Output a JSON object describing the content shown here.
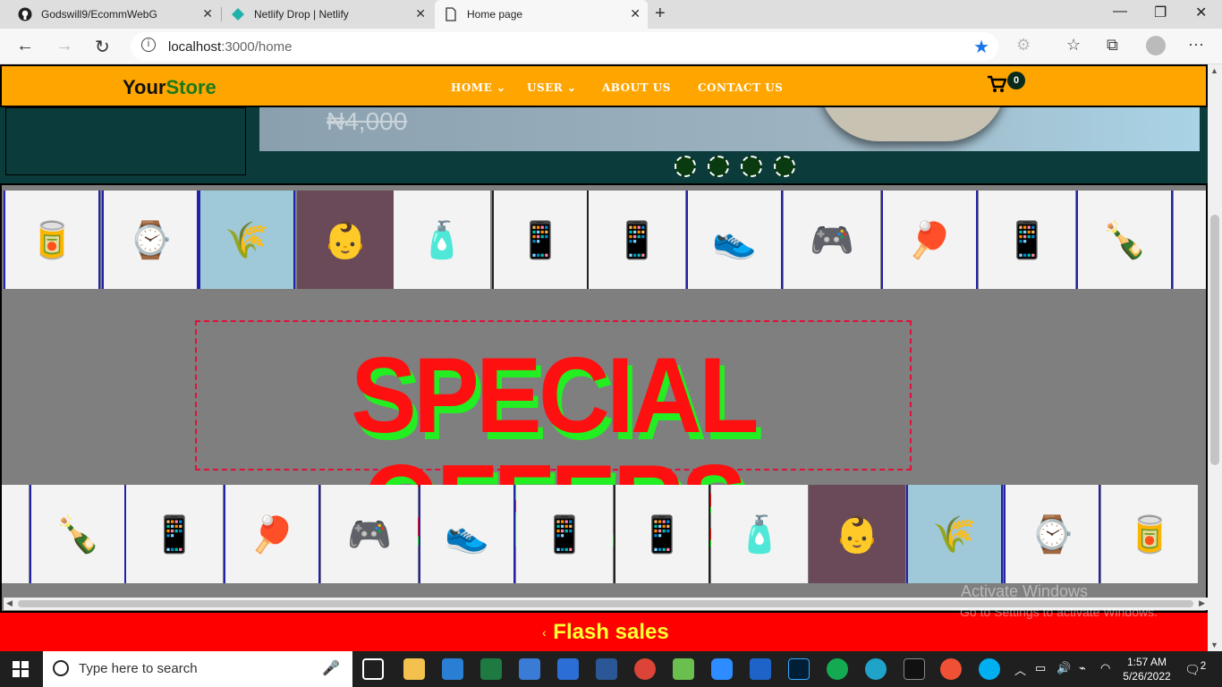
{
  "browser": {
    "tabs": [
      {
        "title": "Godswill9/EcommWebG"
      },
      {
        "title": "Netlify Drop | Netlify"
      },
      {
        "title": "Home page"
      }
    ],
    "url_host": "localhost",
    "url_rest": ":3000/home"
  },
  "navbar": {
    "brand_part1": "Your",
    "brand_part2": "Store",
    "menu": [
      "HOME",
      "USER",
      "ABOUT US",
      "CONTACT US"
    ],
    "cart_count": "0"
  },
  "hero": {
    "price": "₦4,000",
    "slide_dots": 4
  },
  "offers": {
    "title": "SPECIAL OFFERS",
    "top_strip": [
      "canned-food",
      "wristwatches",
      "rice-promo",
      "baby-in-hoodie",
      "toiletries",
      "phone-blue",
      "phone-grey",
      "sneakers",
      "game-console",
      "table-tennis",
      "tablet",
      "sauces"
    ],
    "bottom_strip": [
      "sauces",
      "tablet",
      "table-tennis",
      "game-console",
      "sneakers",
      "phone-grey",
      "phone-blue",
      "toiletries",
      "baby-in-hoodie",
      "rice-promo",
      "wristwatches",
      "canned-food"
    ]
  },
  "flash_sales": {
    "title": "Flash sales"
  },
  "watermark": {
    "line1": "Activate Windows",
    "line2": "Go to Settings to activate Windows."
  },
  "taskbar": {
    "search_placeholder": "Type here to search",
    "time": "1:57 AM",
    "date": "5/26/2022",
    "notifications": "2"
  }
}
